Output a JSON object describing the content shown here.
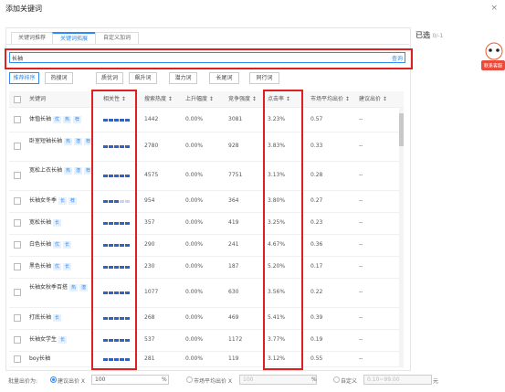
{
  "dialog": {
    "title": "添加关键词",
    "close": "×"
  },
  "tabs": [
    {
      "label": "关键词推荐",
      "active": false
    },
    {
      "label": "关键词拓展",
      "active": true
    },
    {
      "label": "自定义加词",
      "active": false
    }
  ],
  "search": {
    "value": "长袖",
    "button": "查询"
  },
  "filters": [
    {
      "label": "推荐排序",
      "active": true
    },
    {
      "label": "热搜词",
      "active": false
    },
    {
      "label": "质优词",
      "active": false
    },
    {
      "label": "飙升词",
      "active": false
    },
    {
      "label": "潜力词",
      "active": false
    },
    {
      "label": "长尾词",
      "active": false
    },
    {
      "label": "同行词",
      "active": false
    }
  ],
  "columns": {
    "keyword": "关键词",
    "relevance": "相关性 ↕",
    "search": "搜索热度 ↕",
    "rise": "上升幅度 ↕",
    "competition": "竞争强度 ↕",
    "ctr": "点击率 ↕",
    "avg_bid": "市场平均出价 ↕",
    "suggest_bid": "建议出价 ↕"
  },
  "rows": [
    {
      "keyword": "体恤长袖",
      "tags": [
        "优",
        "热",
        "荐"
      ],
      "relevance": 5,
      "search": "1442",
      "rise": "0.00%",
      "competition": "3081",
      "ctr": "3.23%",
      "avg_bid": "0.57",
      "suggest_bid": "--"
    },
    {
      "keyword": "卧室短袖长袖",
      "tags": [
        "热",
        "潜",
        "荐"
      ],
      "relevance": 5,
      "search": "2780",
      "rise": "0.00%",
      "competition": "928",
      "ctr": "3.83%",
      "avg_bid": "0.33",
      "suggest_bid": "--"
    },
    {
      "keyword": "宽松上衣长袖",
      "tags": [
        "热",
        "潜",
        "荐"
      ],
      "relevance": 5,
      "search": "4575",
      "rise": "0.00%",
      "competition": "7751",
      "ctr": "3.13%",
      "avg_bid": "0.28",
      "suggest_bid": "--"
    },
    {
      "keyword": "长袖女冬季",
      "tags": [
        "长",
        "荐"
      ],
      "relevance": 3,
      "search": "954",
      "rise": "0.00%",
      "competition": "364",
      "ctr": "3.80%",
      "avg_bid": "0.27",
      "suggest_bid": "--"
    },
    {
      "keyword": "宽松长袖",
      "tags": [
        "长"
      ],
      "relevance": 5,
      "search": "357",
      "rise": "0.00%",
      "competition": "419",
      "ctr": "3.25%",
      "avg_bid": "0.23",
      "suggest_bid": "--"
    },
    {
      "keyword": "白色长袖",
      "tags": [
        "优",
        "长"
      ],
      "relevance": 5,
      "search": "290",
      "rise": "0.00%",
      "competition": "241",
      "ctr": "4.67%",
      "avg_bid": "0.36",
      "suggest_bid": "--"
    },
    {
      "keyword": "黑色长袖",
      "tags": [
        "优",
        "长"
      ],
      "relevance": 5,
      "search": "230",
      "rise": "0.00%",
      "competition": "187",
      "ctr": "5.20%",
      "avg_bid": "0.17",
      "suggest_bid": "--"
    },
    {
      "keyword": "长袖女秋季百搭",
      "tags": [
        "热",
        "潜"
      ],
      "relevance": 5,
      "search": "1077",
      "rise": "0.00%",
      "competition": "630",
      "ctr": "3.56%",
      "avg_bid": "0.22",
      "suggest_bid": "--"
    },
    {
      "keyword": "打底长袖",
      "tags": [
        "长"
      ],
      "relevance": 5,
      "search": "268",
      "rise": "0.00%",
      "competition": "469",
      "ctr": "5.41%",
      "avg_bid": "0.39",
      "suggest_bid": "--"
    },
    {
      "keyword": "长袖女学生",
      "tags": [
        "长"
      ],
      "relevance": 5,
      "search": "537",
      "rise": "0.00%",
      "competition": "1172",
      "ctr": "3.77%",
      "avg_bid": "0.19",
      "suggest_bid": "--"
    },
    {
      "keyword": "boy长袖",
      "tags": [],
      "relevance": 5,
      "search": "281",
      "rise": "0.00%",
      "competition": "119",
      "ctr": "3.12%",
      "avg_bid": "0.55",
      "suggest_bid": "--"
    }
  ],
  "bottom": {
    "label": "批量出价为:",
    "opt1": "建议出价 X",
    "opt1_value": "100",
    "unit": "%",
    "opt2": "市场平均出价 X",
    "opt2_value": "100",
    "opt3": "自定义",
    "opt3_placeholder": "0.10~99.00",
    "yuan": "元"
  },
  "selected": {
    "label": "已选",
    "count": "0/-1"
  },
  "mascot": {
    "text": "联系客服"
  },
  "colors": {
    "accent": "#2d8cf0",
    "highlight": "#e02020"
  }
}
